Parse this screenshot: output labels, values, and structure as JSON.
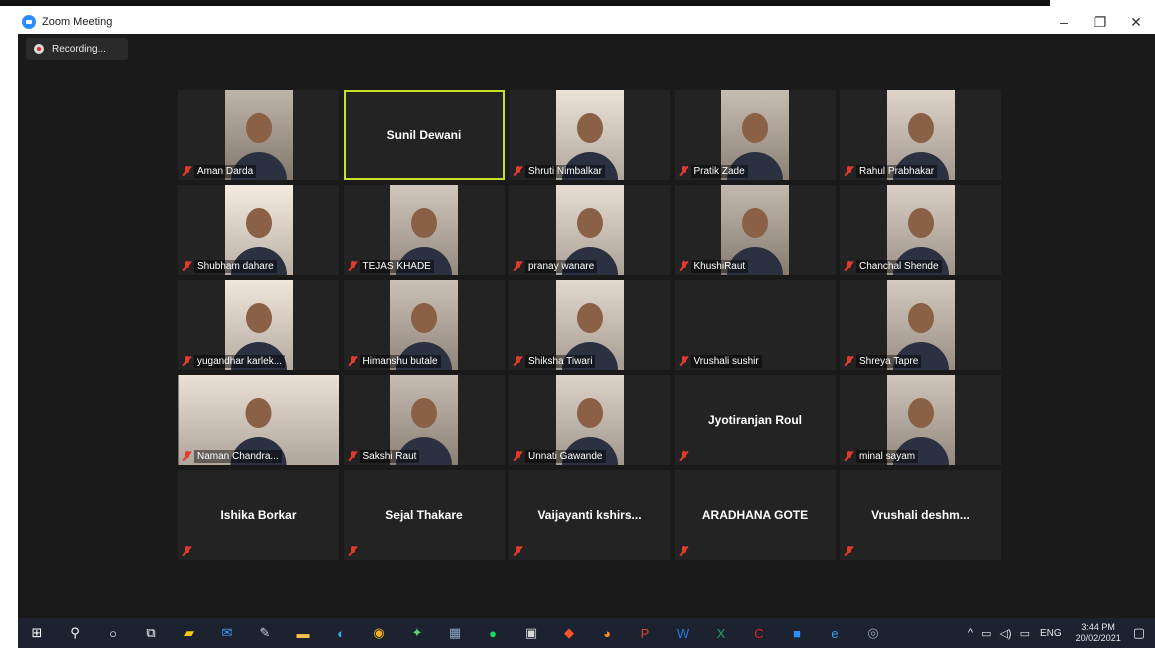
{
  "window": {
    "title": "Zoom Meeting",
    "minimize_glyph": "–",
    "restore_glyph": "❐",
    "close_glyph": "✕"
  },
  "recording": {
    "label": "Recording..."
  },
  "participants": [
    {
      "name": "Aman Darda",
      "video": true,
      "muted": true,
      "active": false
    },
    {
      "name": "Sunil Dewani",
      "video": false,
      "muted": false,
      "active": true
    },
    {
      "name": "Shruti Nimbalkar",
      "video": true,
      "muted": true,
      "active": false
    },
    {
      "name": "Pratik Zade",
      "video": true,
      "muted": true,
      "active": false
    },
    {
      "name": "Rahul Prabhakar",
      "video": true,
      "muted": true,
      "active": false
    },
    {
      "name": "Shubham dahare",
      "video": true,
      "muted": true,
      "active": false
    },
    {
      "name": "TEJAS KHADE",
      "video": true,
      "muted": true,
      "active": false
    },
    {
      "name": "pranay wanare",
      "video": true,
      "muted": true,
      "active": false
    },
    {
      "name": "KhushiRaut",
      "video": true,
      "muted": true,
      "active": false
    },
    {
      "name": "Chanchal Shende",
      "video": true,
      "muted": true,
      "active": false
    },
    {
      "name": "yugandhar karlek...",
      "video": true,
      "muted": true,
      "active": false
    },
    {
      "name": "Himanshu butale",
      "video": true,
      "muted": true,
      "active": false
    },
    {
      "name": "Shiksha Tiwari",
      "video": true,
      "muted": true,
      "active": false
    },
    {
      "name": "Vrushali sushir",
      "video": false,
      "muted": true,
      "active": false,
      "label_only": true
    },
    {
      "name": "Shreya Tapre",
      "video": true,
      "muted": true,
      "active": false
    },
    {
      "name": "Naman Chandra...",
      "video": true,
      "muted": true,
      "active": false,
      "wide": true
    },
    {
      "name": "Sakshi Raut",
      "video": true,
      "muted": true,
      "active": false
    },
    {
      "name": "Unnati Gawande",
      "video": true,
      "muted": true,
      "active": false
    },
    {
      "name": "Jyotiranjan Roul",
      "video": false,
      "muted": true,
      "active": false
    },
    {
      "name": "minal sayam",
      "video": true,
      "muted": true,
      "active": false
    },
    {
      "name": "Ishika Borkar",
      "video": false,
      "muted": true,
      "active": false
    },
    {
      "name": "Sejal Thakare",
      "video": false,
      "muted": true,
      "active": false
    },
    {
      "name": "Vaijayanti  kshirs...",
      "video": false,
      "muted": true,
      "active": false
    },
    {
      "name": "ARADHANA GOTE",
      "video": false,
      "muted": true,
      "active": false
    },
    {
      "name": "Vrushali  deshm...",
      "video": false,
      "muted": true,
      "active": false
    }
  ],
  "taskbar": {
    "apps": [
      {
        "name": "start-icon",
        "glyph": "⊞",
        "color": "#ffffff"
      },
      {
        "name": "search-icon",
        "glyph": "⚲",
        "color": "#ffffff"
      },
      {
        "name": "cortana-icon",
        "glyph": "○",
        "color": "#ffffff"
      },
      {
        "name": "task-view-icon",
        "glyph": "⧉",
        "color": "#ffffff"
      },
      {
        "name": "sticky-notes-icon",
        "glyph": "▰",
        "color": "#f2c811"
      },
      {
        "name": "mail-icon",
        "glyph": "✉",
        "color": "#3b9cff"
      },
      {
        "name": "paint-icon",
        "glyph": "✎",
        "color": "#c9d4e6"
      },
      {
        "name": "file-explorer-icon",
        "glyph": "▬",
        "color": "#f5c04a"
      },
      {
        "name": "edge-icon",
        "glyph": "◐",
        "color": "#2fb0e8"
      },
      {
        "name": "chrome-icon",
        "glyph": "◉",
        "color": "#f2b01e"
      },
      {
        "name": "maps-icon",
        "glyph": "✦",
        "color": "#5cd07a"
      },
      {
        "name": "calculator-icon",
        "glyph": "▦",
        "color": "#8fa7c7"
      },
      {
        "name": "spotify-icon",
        "glyph": "●",
        "color": "#1ed760"
      },
      {
        "name": "app-icon",
        "glyph": "▣",
        "color": "#d8d8d8"
      },
      {
        "name": "brave-icon",
        "glyph": "◆",
        "color": "#fb542b"
      },
      {
        "name": "firefox-icon",
        "glyph": "◕",
        "color": "#ff8a1f"
      },
      {
        "name": "powerpoint-icon",
        "glyph": "P",
        "color": "#d24726"
      },
      {
        "name": "word-icon",
        "glyph": "W",
        "color": "#2b79d8"
      },
      {
        "name": "excel-icon",
        "glyph": "X",
        "color": "#21a366"
      },
      {
        "name": "cisco-icon",
        "glyph": "C",
        "color": "#e0202a"
      },
      {
        "name": "zoom-icon",
        "glyph": "■",
        "color": "#2d8cff"
      },
      {
        "name": "internet-explorer-icon",
        "glyph": "e",
        "color": "#3aa1e6"
      },
      {
        "name": "settings-icon",
        "glyph": "◎",
        "color": "#9aa9bd"
      }
    ],
    "tray": {
      "chevron": "^",
      "battery": "▭",
      "volume": "◁)",
      "network": "▭",
      "lang": "ENG"
    },
    "time": "3:44 PM",
    "date": "20/02/2021",
    "notifications_glyph": "▢"
  },
  "colors": {
    "meeting_bg": "#1a1a1a",
    "tile_bg": "#232323",
    "active_speaker": "#c8e02a",
    "muted_red": "#e23b2e"
  }
}
